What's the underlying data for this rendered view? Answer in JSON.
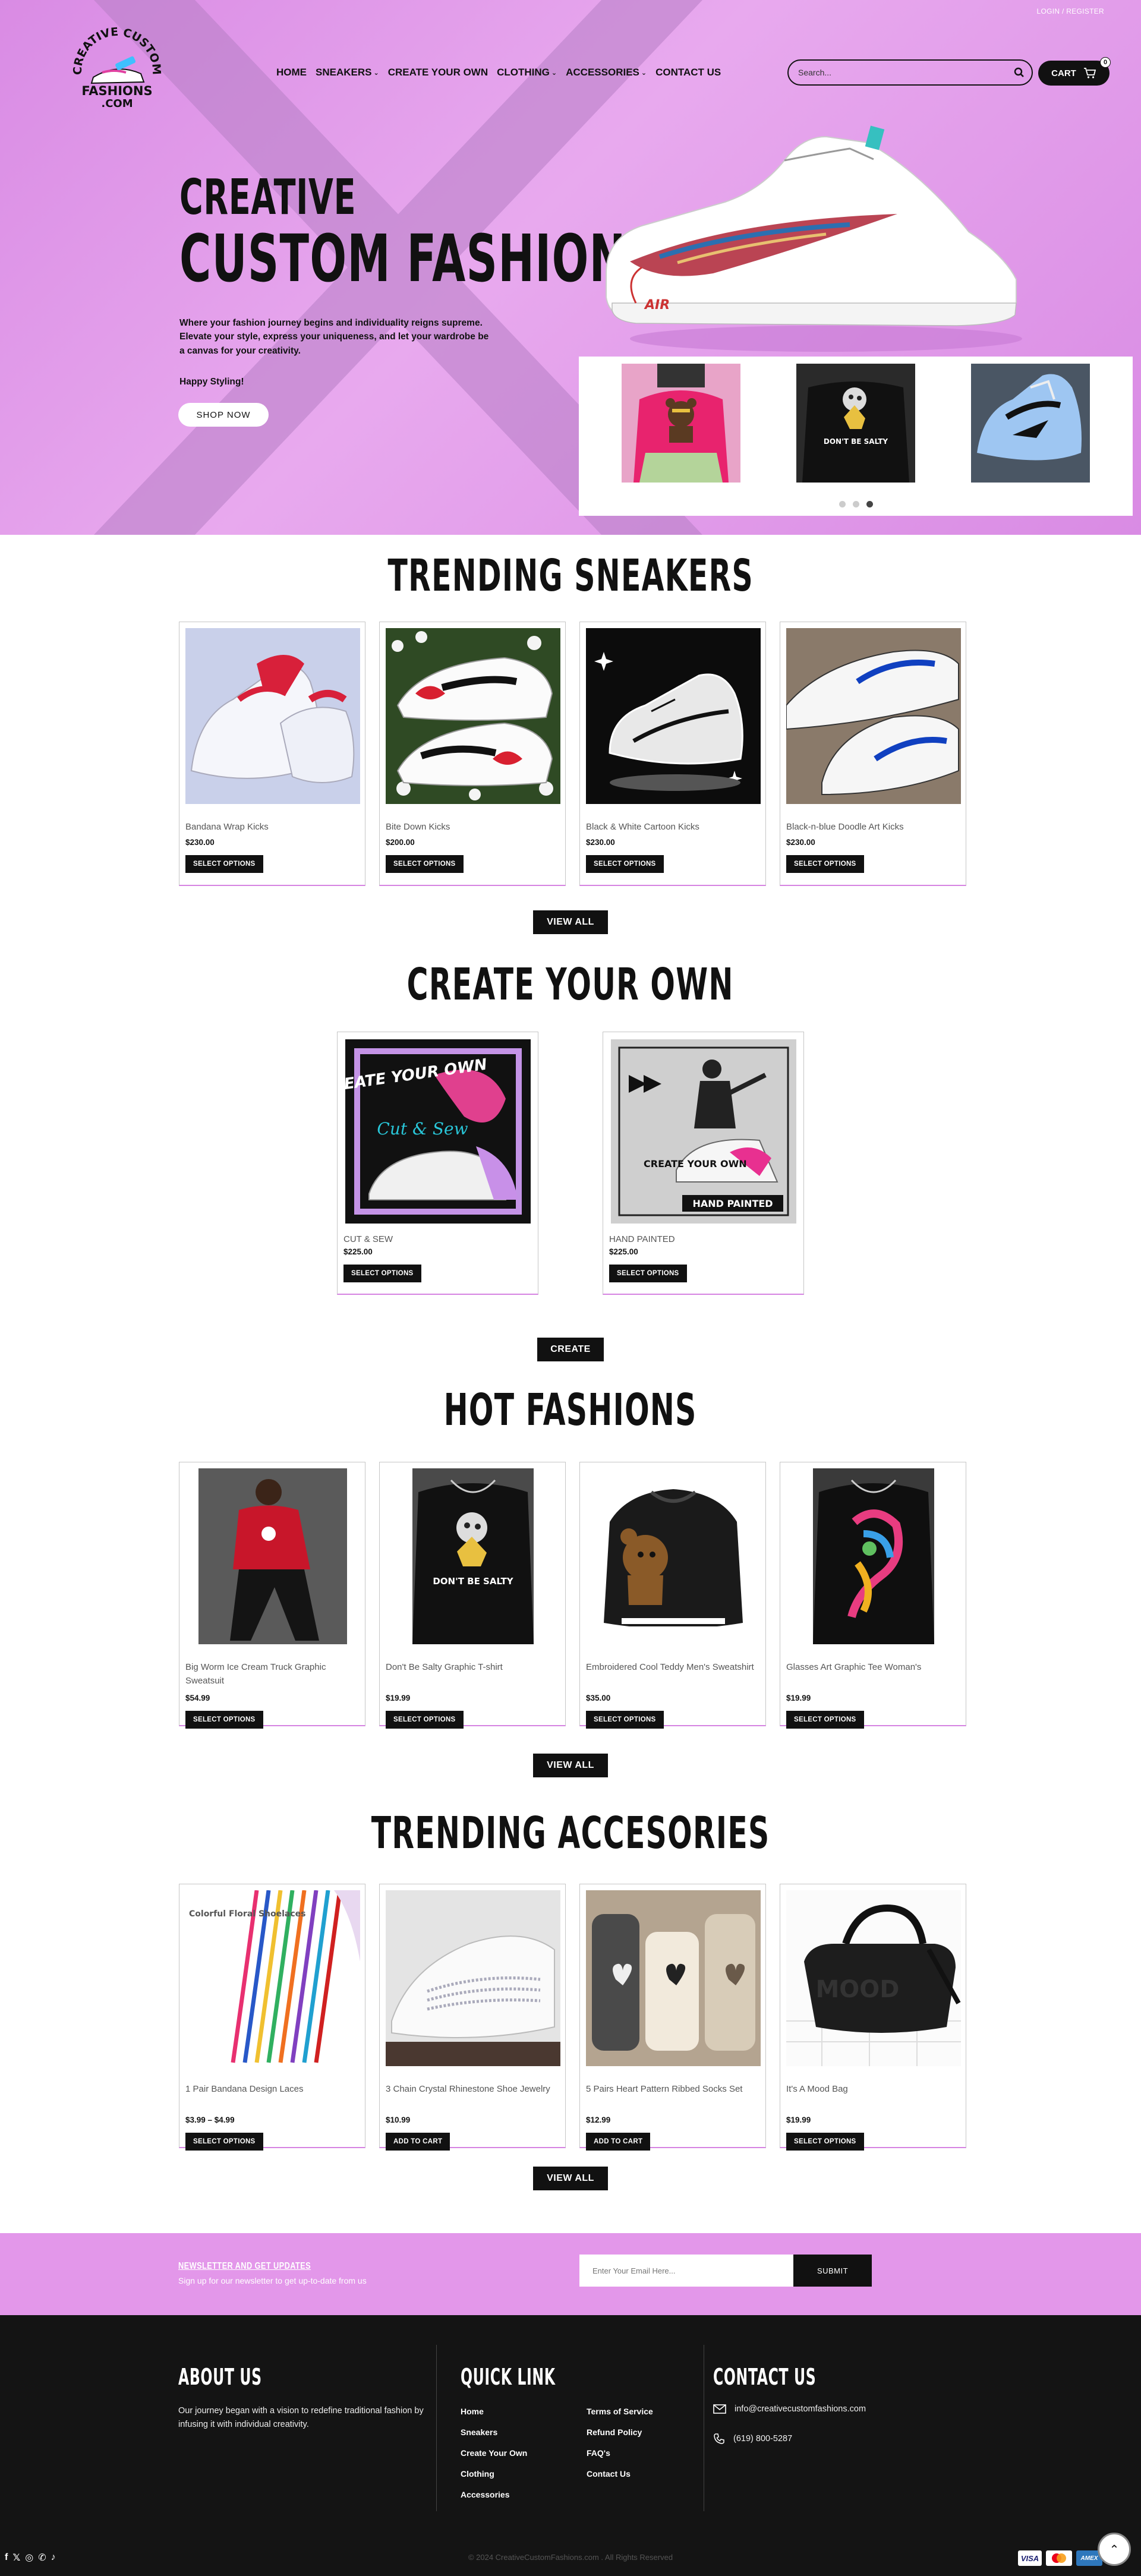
{
  "header": {
    "account_link": "LOGIN / REGISTER",
    "logo_text": [
      "CREATIVE CUSTOM",
      "FASHIONS",
      ".COM"
    ],
    "nav": [
      {
        "label": "HOME",
        "dropdown": false
      },
      {
        "label": "SNEAKERS",
        "dropdown": true
      },
      {
        "label": "CREATE YOUR OWN",
        "dropdown": false
      },
      {
        "label": "CLOTHING",
        "dropdown": true
      },
      {
        "label": "ACCESSORIES",
        "dropdown": true
      },
      {
        "label": "CONTACT US",
        "dropdown": false
      }
    ],
    "search_placeholder": "Search...",
    "cart_label": "CART",
    "cart_count": "0"
  },
  "hero": {
    "title_line1": "CREATIVE",
    "title_line2": "CUSTOM FASHIONS",
    "description": "Where your fashion journey begins and individuality reigns supreme. Elevate your style, express your uniqueness, and let your wardrobe be a canvas for your creativity.",
    "tagline": "Happy Styling!",
    "shop_button": "SHOP NOW",
    "shoe_brand": "AIR",
    "slide_tee_text": "DON'T BE SALTY",
    "carousel_active": 3,
    "carousel_dots": 3
  },
  "trending_sneakers": {
    "title": "TRENDING SNEAKERS",
    "view_all": "VIEW ALL",
    "products": [
      {
        "name": "Bandana Wrap Kicks",
        "price": "$230.00",
        "button": "SELECT OPTIONS"
      },
      {
        "name": "Bite Down Kicks",
        "price": "$200.00",
        "button": "SELECT OPTIONS"
      },
      {
        "name": "Black & White Cartoon Kicks",
        "price": "$230.00",
        "button": "SELECT OPTIONS"
      },
      {
        "name": "Black-n-blue Doodle Art Kicks",
        "price": "$230.00",
        "button": "SELECT OPTIONS"
      }
    ]
  },
  "create_your_own": {
    "title": "CREATE YOUR OWN",
    "button": "CREATE",
    "products": [
      {
        "name": "CUT & SEW",
        "price": "$225.00",
        "button": "SELECT OPTIONS",
        "img_text1": "CREATE YOUR OWN",
        "img_text2": "Cut & Sew"
      },
      {
        "name": "HAND PAINTED",
        "price": "$225.00",
        "button": "SELECT OPTIONS",
        "img_text1": "CREATE YOUR OWN",
        "img_text2": "HAND PAINTED"
      }
    ]
  },
  "hot_fashions": {
    "title": "HOT FASHIONS",
    "view_all": "VIEW ALL",
    "products": [
      {
        "name": "Big Worm Ice Cream Truck Graphic Sweatsuit",
        "price": "$54.99",
        "button": "SELECT OPTIONS"
      },
      {
        "name": "Don't Be Salty Graphic T-shirt",
        "price": "$19.99",
        "button": "SELECT OPTIONS",
        "img_text": "DON'T BE SALTY"
      },
      {
        "name": "Embroidered Cool Teddy Men's Sweatshirt",
        "price": "$35.00",
        "button": "SELECT OPTIONS"
      },
      {
        "name": "Glasses Art Graphic Tee Woman's",
        "price": "$19.99",
        "button": "SELECT OPTIONS"
      }
    ]
  },
  "trending_accessories": {
    "title": "TRENDING ACCESORIES",
    "view_all": "VIEW ALL",
    "products": [
      {
        "name": "1 Pair Bandana Design Laces",
        "price": "$3.99 – $4.99",
        "button": "SELECT OPTIONS",
        "img_text": "Colorful Floral Shoelaces"
      },
      {
        "name": "3 Chain Crystal Rhinestone Shoe Jewelry",
        "price": "$10.99",
        "button": "ADD TO CART"
      },
      {
        "name": "5 Pairs Heart Pattern Ribbed Socks Set",
        "price": "$12.99",
        "button": "ADD TO CART"
      },
      {
        "name": "It's A Mood Bag",
        "price": "$19.99",
        "button": "SELECT OPTIONS",
        "img_text": "MOOD"
      }
    ]
  },
  "newsletter": {
    "title": "NEWSLETTER AND GET UPDATES",
    "subtitle": "Sign up for our newsletter to get up-to-date from us",
    "input_placeholder": "Enter Your Email Here...",
    "submit": "SUBMIT"
  },
  "footer": {
    "about_title": "ABOUT US",
    "about_text": "Our journey began with a vision to redefine traditional fashion by infusing it with individual creativity.",
    "quick_title": "QUICK LINK",
    "quick_links_col1": [
      "Home",
      "Sneakers",
      "Create Your Own",
      "Clothing",
      "Accessories"
    ],
    "quick_links_col2": [
      "Terms of Service",
      "Refund Policy",
      "FAQ's",
      "Contact Us"
    ],
    "contact_title": "CONTACT US",
    "email": "info@creativecustomfashions.com",
    "phone": "(619) 800-5287",
    "copyright": "© 2024 CreativeCustomFashions.com . All Rights Reserved",
    "payments": [
      "VISA",
      "mastercard",
      "AMEX"
    ]
  },
  "colors": {
    "accent_pink": "#d98be4",
    "newsletter_pink": "#e397ea",
    "footer_bg": "#141414",
    "button_black": "#111111"
  }
}
